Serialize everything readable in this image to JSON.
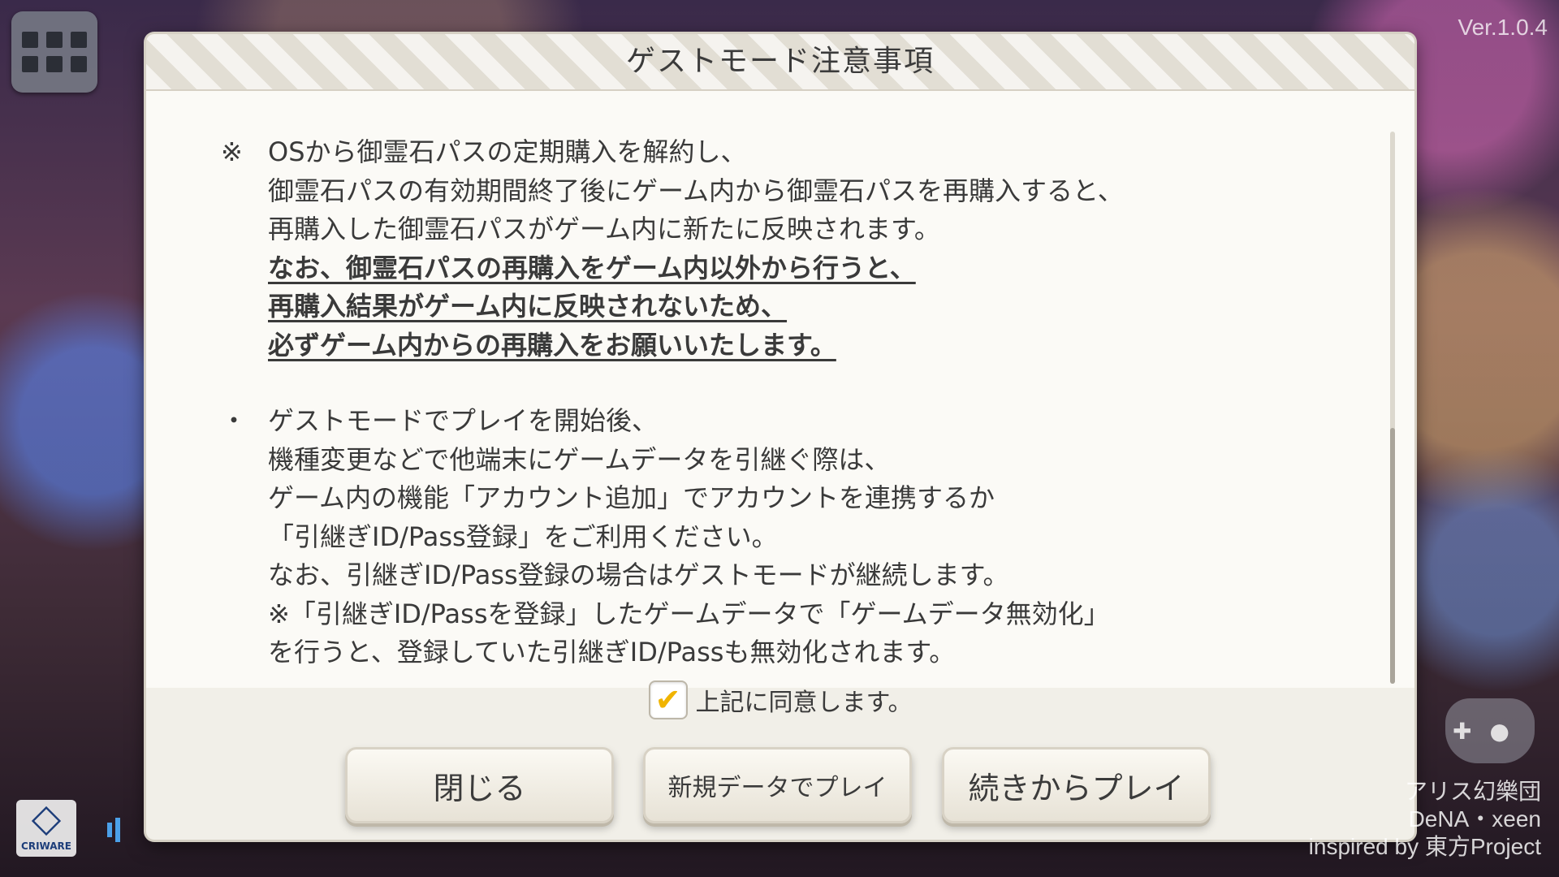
{
  "version": "Ver.1.0.4",
  "dialog": {
    "title": "ゲストモード注意事項",
    "section1": {
      "mark": "※",
      "lines": [
        "OSから御霊石パスの定期購入を解約し、",
        "御霊石パスの有効期間終了後にゲーム内から御霊石パスを再購入すると、",
        "再購入した御霊石パスがゲーム内に新たに反映されます。"
      ],
      "bold_lines": [
        "なお、御霊石パスの再購入をゲーム内以外から行うと、",
        "再購入結果がゲーム内に反映されないため、",
        "必ずゲーム内からの再購入をお願いいたします。"
      ]
    },
    "section2": {
      "mark": "・",
      "lines": [
        "ゲストモードでプレイを開始後、",
        "機種変更などで他端末にゲームデータを引継ぐ際は、",
        "ゲーム内の機能「アカウント追加」でアカウントを連携するか",
        "「引継ぎID/Pass登録」をご利用ください。",
        "なお、引継ぎID/Pass登録の場合はゲストモードが継続します。",
        "※「引継ぎID/Passを登録」したゲームデータで「ゲームデータ無効化」",
        "を行うと、登録していた引継ぎID/Passも無効化されます。"
      ]
    },
    "agree": {
      "checked": true,
      "check_glyph": "✔",
      "label": "上記に同意します。"
    },
    "buttons": {
      "close": "閉じる",
      "new_data": "新規データでプレイ",
      "continue": "続きからプレイ"
    }
  },
  "credits": [
    "アリス幻樂団",
    "DeNA・xeen",
    "inspired by 東方Project"
  ],
  "criware_label": "CRIWARE",
  "colors": {
    "check": "#f0b400",
    "dialog_bg": "#f1efe8",
    "text": "#3a3a3a"
  }
}
